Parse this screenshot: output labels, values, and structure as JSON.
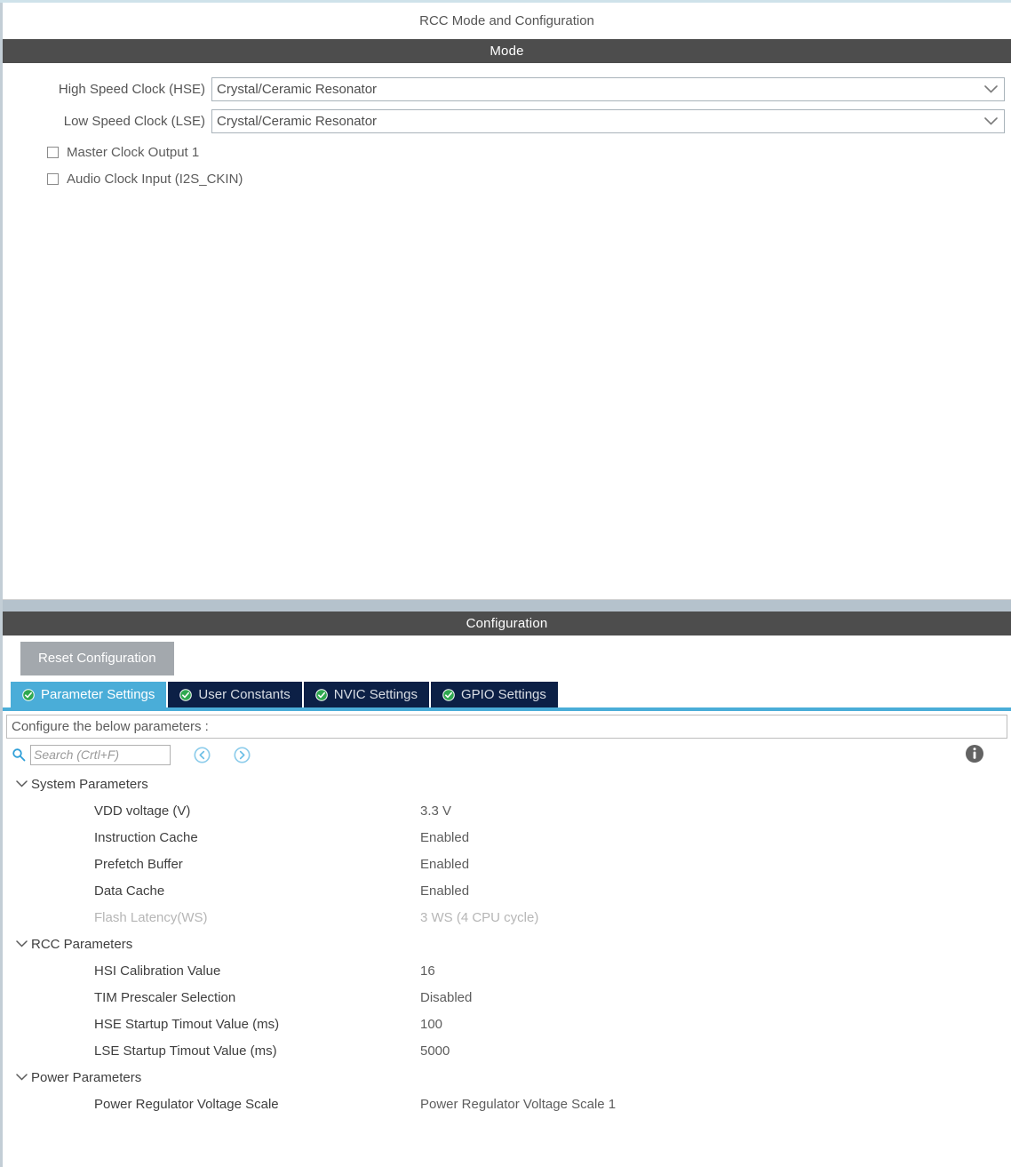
{
  "window": {
    "title": "RCC Mode and Configuration"
  },
  "mode": {
    "band_label": "Mode",
    "fields": [
      {
        "label": "High Speed Clock (HSE)",
        "value": "Crystal/Ceramic Resonator"
      },
      {
        "label": "Low Speed Clock (LSE)",
        "value": "Crystal/Ceramic Resonator"
      }
    ],
    "checkboxes": [
      {
        "label": "Master Clock Output 1",
        "checked": false
      },
      {
        "label": "Audio Clock Input (I2S_CKIN)",
        "checked": false
      }
    ]
  },
  "configuration": {
    "band_label": "Configuration",
    "reset_label": "Reset Configuration",
    "tabs": [
      {
        "label": "Parameter Settings",
        "active": true
      },
      {
        "label": "User Constants",
        "active": false
      },
      {
        "label": "NVIC Settings",
        "active": false
      },
      {
        "label": "GPIO Settings",
        "active": false
      }
    ],
    "configure_hint": "Configure the below parameters :",
    "search": {
      "placeholder": "Search (Crtl+F)",
      "value": ""
    },
    "icons": {
      "search": "search-icon",
      "prev": "previous-icon",
      "next": "next-icon",
      "info": "info-icon",
      "tab_status": "checkmark-icon"
    },
    "groups": [
      {
        "label": "System Parameters",
        "expanded": true,
        "params": [
          {
            "name": "VDD voltage (V)",
            "value": "3.3 V",
            "disabled": false
          },
          {
            "name": "Instruction Cache",
            "value": "Enabled",
            "disabled": false
          },
          {
            "name": "Prefetch Buffer",
            "value": "Enabled",
            "disabled": false
          },
          {
            "name": "Data Cache",
            "value": "Enabled",
            "disabled": false
          },
          {
            "name": "Flash Latency(WS)",
            "value": "3 WS (4 CPU cycle)",
            "disabled": true
          }
        ]
      },
      {
        "label": "RCC Parameters",
        "expanded": true,
        "params": [
          {
            "name": "HSI Calibration Value",
            "value": "16",
            "disabled": false
          },
          {
            "name": "TIM Prescaler Selection",
            "value": "Disabled",
            "disabled": false
          },
          {
            "name": "HSE Startup Timout Value (ms)",
            "value": "100",
            "disabled": false
          },
          {
            "name": "LSE Startup Timout Value (ms)",
            "value": "5000",
            "disabled": false
          }
        ]
      },
      {
        "label": "Power Parameters",
        "expanded": true,
        "params": [
          {
            "name": "Power Regulator Voltage Scale",
            "value": "Power Regulator Voltage Scale 1",
            "disabled": false
          }
        ]
      }
    ]
  },
  "colors": {
    "band": "#4d4d4d",
    "tab_active": "#4aadd8",
    "tab_inactive": "#0c2046",
    "splitter": "#b5c2cc",
    "reset_button": "#a3a8ad",
    "accent": "#4aadd8"
  }
}
